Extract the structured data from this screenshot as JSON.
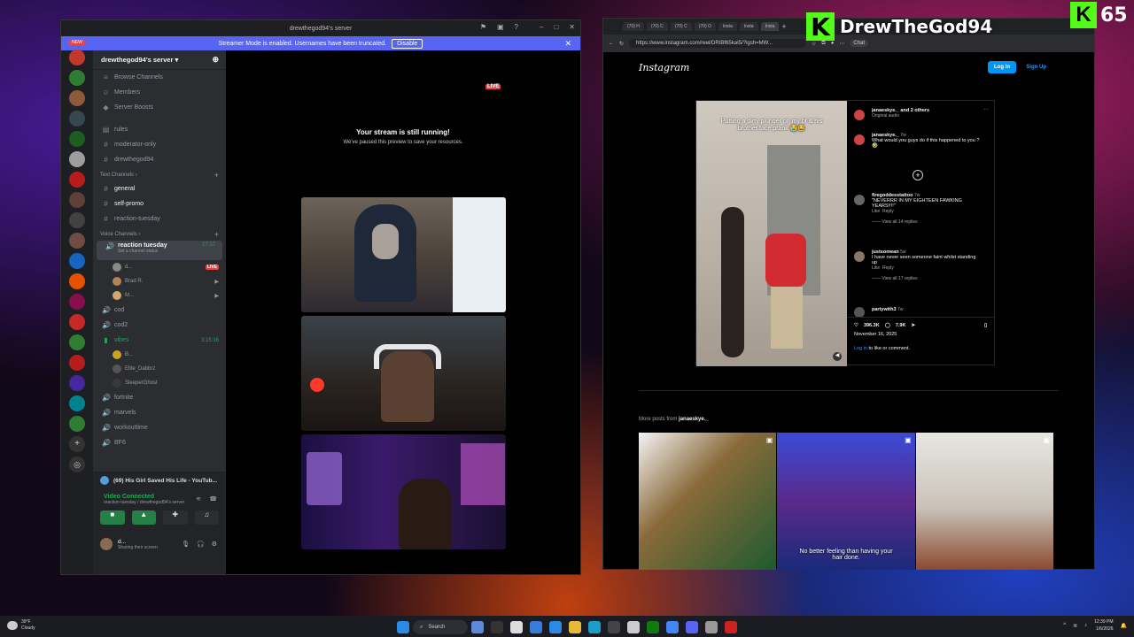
{
  "brand": {
    "name": "DrewTheGod94",
    "count": "65",
    "k": "K"
  },
  "discord": {
    "window_title": "drewthegod94's server",
    "banner": {
      "text": "Streamer Mode is enabled. Usernames have been truncated.",
      "button": "Disable"
    },
    "guild_new": "NEW",
    "server_name": "drewthegod94's server",
    "top_items": [
      "Browse Channels",
      "Members",
      "Server Boosts"
    ],
    "channels_top": [
      "rules",
      "moderator-only",
      "drewthegod94"
    ],
    "text_category": "Text Channels",
    "text_channels": [
      "general",
      "self-promo",
      "reaction-tuesday"
    ],
    "voice_category": "Voice Channels",
    "voice_active": {
      "name": "reaction tuesday",
      "time": "27:17",
      "status": "Set a channel status"
    },
    "voice_users": [
      {
        "name": "d...",
        "live": "LIVE"
      },
      {
        "name": "Brad R."
      },
      {
        "name": "M..."
      }
    ],
    "voice_channels_mid": [
      "cod",
      "cod2"
    ],
    "vibes": {
      "name": "vibes",
      "time": "3:15:16",
      "users": [
        "B...",
        "Elite_Dabbrz",
        "SleeperGhost"
      ]
    },
    "voice_channels_end": [
      "fortnite",
      "marvels",
      "workouttime",
      "BF6"
    ],
    "activity": "(69) His Girl Saved His Life - YouTub...",
    "connected": {
      "title": "Video Connected",
      "sub": "reaction tuesday / drewthegod94's server"
    },
    "user": {
      "name": "d...",
      "status": "Sharing their screen"
    },
    "stage": {
      "live": "LIVE",
      "title": "Your stream is still running!",
      "sub": "We've paused this preview to save your resources."
    }
  },
  "browser": {
    "tabs": [
      "(70) H",
      "(70) C",
      "(70) C",
      "(70) O",
      "Insta",
      "Insta",
      "Insta"
    ],
    "url": "https://www.instagram.com/reel/DRIBf65kaI5/?igsh=MW...",
    "chat": "Chat",
    "logo": "Instagram",
    "login": "Log In",
    "signup": "Sign Up",
    "post": {
      "author": "janaeskye._ and 2 others",
      "audio": "Original audio",
      "caption_overlay": "Putting a dirty plunger on my bf & his brother face prank 😭😂",
      "comments": [
        {
          "user": "janaeskye._",
          "age": "7w",
          "text": "What would you guys do if this happened to you ? 🤣"
        },
        {
          "user": "firegoddesstattoo",
          "age": "7w",
          "text": "\"NEVERRR IN MY EIGHTEEN FAWKING YEARS!!!!\"",
          "like": "Like",
          "reply": "Reply",
          "replies": "View all 14 replies"
        },
        {
          "user": "justsomean",
          "age": "5w",
          "text": "I have never seen someone faint whilst standing up",
          "like": "Like",
          "reply": "Reply",
          "replies": "View all 17 replies"
        },
        {
          "user": "partywith3",
          "age": "7w"
        }
      ],
      "likes": "396.3K",
      "comments_count": "7.9K",
      "date": "November 16, 2025",
      "login_link": "Log in",
      "login_rest": "to like or comment."
    },
    "more_posts_prefix": "More posts from",
    "more_posts_user": "janaeskye._",
    "thumb_caption": "No better feeling than having your hair done."
  },
  "taskbar": {
    "weather": "39°F",
    "weather_sub": "Cloudy",
    "search": "Search",
    "time": "12:39 PM",
    "date": "1/6/2026"
  }
}
